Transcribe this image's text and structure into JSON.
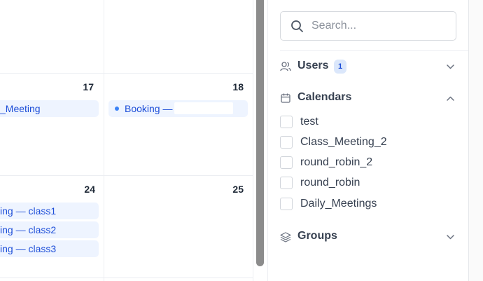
{
  "calendar": {
    "day_numbers": [
      "17",
      "18",
      "24",
      "25"
    ],
    "events": {
      "meeting_17": "_Meeting",
      "booking_18": "Booking —",
      "class1": "ing — class1",
      "class2": "ing — class2",
      "class3": "ing — class3"
    }
  },
  "sidebar": {
    "search": {
      "placeholder": "Search..."
    },
    "users": {
      "title": "Users",
      "count": "1"
    },
    "calendars": {
      "title": "Calendars",
      "items": [
        {
          "label": "test",
          "checked": false
        },
        {
          "label": "Class_Meeting_2",
          "checked": false
        },
        {
          "label": "round_robin_2",
          "checked": false
        },
        {
          "label": "round_robin",
          "checked": false
        },
        {
          "label": "Daily_Meetings",
          "checked": false
        }
      ]
    },
    "groups": {
      "title": "Groups"
    }
  },
  "icons": {
    "search": "search-icon",
    "users": "users-icon",
    "calendars": "calendar-icon",
    "groups": "layers-icon",
    "collapse": "chevron-down-icon",
    "expand": "chevron-up-icon"
  },
  "colors": {
    "accent": "#1d4ed8",
    "event_bg": "#eef4ff",
    "badge_bg": "#dbe7fb"
  }
}
